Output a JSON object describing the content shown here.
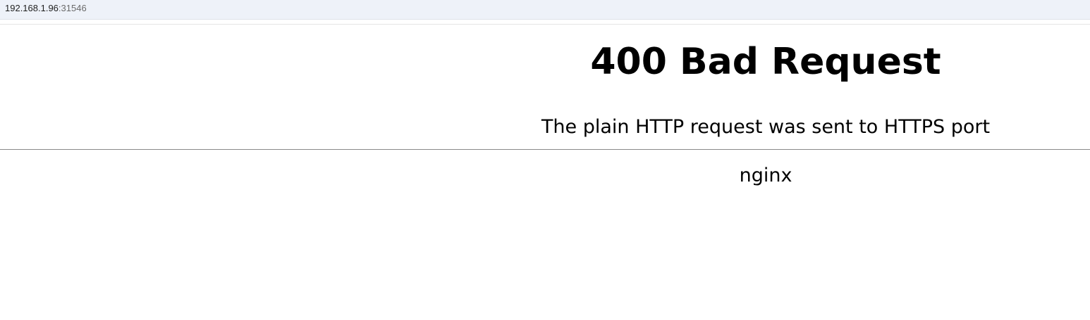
{
  "address_bar": {
    "host": "192.168.1.96",
    "port": ":31546"
  },
  "page": {
    "title": "400 Bad Request",
    "message": "The plain HTTP request was sent to HTTPS port",
    "server": "nginx"
  }
}
